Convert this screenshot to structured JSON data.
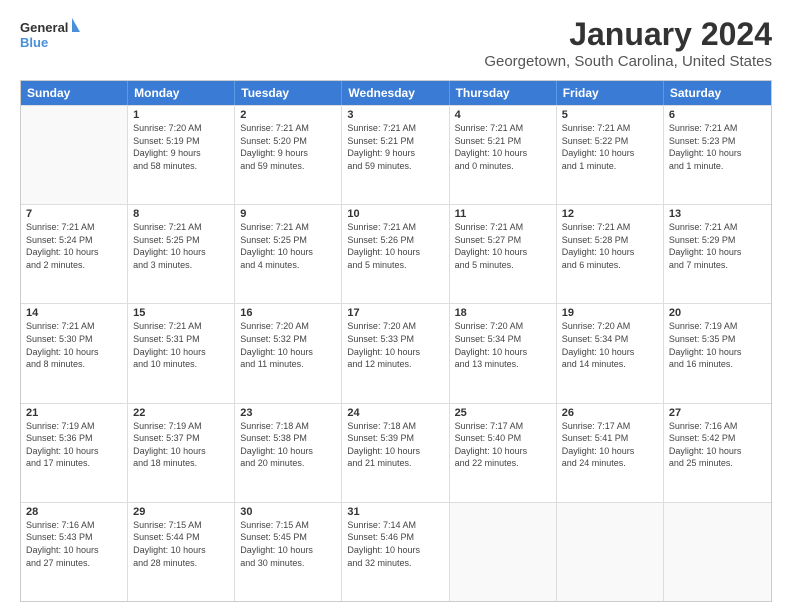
{
  "logo": {
    "line1": "General",
    "line2": "Blue"
  },
  "title": "January 2024",
  "subtitle": "Georgetown, South Carolina, United States",
  "header_days": [
    "Sunday",
    "Monday",
    "Tuesday",
    "Wednesday",
    "Thursday",
    "Friday",
    "Saturday"
  ],
  "weeks": [
    [
      {
        "day": "",
        "info": ""
      },
      {
        "day": "1",
        "info": "Sunrise: 7:20 AM\nSunset: 5:19 PM\nDaylight: 9 hours\nand 58 minutes."
      },
      {
        "day": "2",
        "info": "Sunrise: 7:21 AM\nSunset: 5:20 PM\nDaylight: 9 hours\nand 59 minutes."
      },
      {
        "day": "3",
        "info": "Sunrise: 7:21 AM\nSunset: 5:21 PM\nDaylight: 9 hours\nand 59 minutes."
      },
      {
        "day": "4",
        "info": "Sunrise: 7:21 AM\nSunset: 5:21 PM\nDaylight: 10 hours\nand 0 minutes."
      },
      {
        "day": "5",
        "info": "Sunrise: 7:21 AM\nSunset: 5:22 PM\nDaylight: 10 hours\nand 1 minute."
      },
      {
        "day": "6",
        "info": "Sunrise: 7:21 AM\nSunset: 5:23 PM\nDaylight: 10 hours\nand 1 minute."
      }
    ],
    [
      {
        "day": "7",
        "info": "Sunrise: 7:21 AM\nSunset: 5:24 PM\nDaylight: 10 hours\nand 2 minutes."
      },
      {
        "day": "8",
        "info": "Sunrise: 7:21 AM\nSunset: 5:25 PM\nDaylight: 10 hours\nand 3 minutes."
      },
      {
        "day": "9",
        "info": "Sunrise: 7:21 AM\nSunset: 5:25 PM\nDaylight: 10 hours\nand 4 minutes."
      },
      {
        "day": "10",
        "info": "Sunrise: 7:21 AM\nSunset: 5:26 PM\nDaylight: 10 hours\nand 5 minutes."
      },
      {
        "day": "11",
        "info": "Sunrise: 7:21 AM\nSunset: 5:27 PM\nDaylight: 10 hours\nand 5 minutes."
      },
      {
        "day": "12",
        "info": "Sunrise: 7:21 AM\nSunset: 5:28 PM\nDaylight: 10 hours\nand 6 minutes."
      },
      {
        "day": "13",
        "info": "Sunrise: 7:21 AM\nSunset: 5:29 PM\nDaylight: 10 hours\nand 7 minutes."
      }
    ],
    [
      {
        "day": "14",
        "info": "Sunrise: 7:21 AM\nSunset: 5:30 PM\nDaylight: 10 hours\nand 8 minutes."
      },
      {
        "day": "15",
        "info": "Sunrise: 7:21 AM\nSunset: 5:31 PM\nDaylight: 10 hours\nand 10 minutes."
      },
      {
        "day": "16",
        "info": "Sunrise: 7:20 AM\nSunset: 5:32 PM\nDaylight: 10 hours\nand 11 minutes."
      },
      {
        "day": "17",
        "info": "Sunrise: 7:20 AM\nSunset: 5:33 PM\nDaylight: 10 hours\nand 12 minutes."
      },
      {
        "day": "18",
        "info": "Sunrise: 7:20 AM\nSunset: 5:34 PM\nDaylight: 10 hours\nand 13 minutes."
      },
      {
        "day": "19",
        "info": "Sunrise: 7:20 AM\nSunset: 5:34 PM\nDaylight: 10 hours\nand 14 minutes."
      },
      {
        "day": "20",
        "info": "Sunrise: 7:19 AM\nSunset: 5:35 PM\nDaylight: 10 hours\nand 16 minutes."
      }
    ],
    [
      {
        "day": "21",
        "info": "Sunrise: 7:19 AM\nSunset: 5:36 PM\nDaylight: 10 hours\nand 17 minutes."
      },
      {
        "day": "22",
        "info": "Sunrise: 7:19 AM\nSunset: 5:37 PM\nDaylight: 10 hours\nand 18 minutes."
      },
      {
        "day": "23",
        "info": "Sunrise: 7:18 AM\nSunset: 5:38 PM\nDaylight: 10 hours\nand 20 minutes."
      },
      {
        "day": "24",
        "info": "Sunrise: 7:18 AM\nSunset: 5:39 PM\nDaylight: 10 hours\nand 21 minutes."
      },
      {
        "day": "25",
        "info": "Sunrise: 7:17 AM\nSunset: 5:40 PM\nDaylight: 10 hours\nand 22 minutes."
      },
      {
        "day": "26",
        "info": "Sunrise: 7:17 AM\nSunset: 5:41 PM\nDaylight: 10 hours\nand 24 minutes."
      },
      {
        "day": "27",
        "info": "Sunrise: 7:16 AM\nSunset: 5:42 PM\nDaylight: 10 hours\nand 25 minutes."
      }
    ],
    [
      {
        "day": "28",
        "info": "Sunrise: 7:16 AM\nSunset: 5:43 PM\nDaylight: 10 hours\nand 27 minutes."
      },
      {
        "day": "29",
        "info": "Sunrise: 7:15 AM\nSunset: 5:44 PM\nDaylight: 10 hours\nand 28 minutes."
      },
      {
        "day": "30",
        "info": "Sunrise: 7:15 AM\nSunset: 5:45 PM\nDaylight: 10 hours\nand 30 minutes."
      },
      {
        "day": "31",
        "info": "Sunrise: 7:14 AM\nSunset: 5:46 PM\nDaylight: 10 hours\nand 32 minutes."
      },
      {
        "day": "",
        "info": ""
      },
      {
        "day": "",
        "info": ""
      },
      {
        "day": "",
        "info": ""
      }
    ]
  ]
}
